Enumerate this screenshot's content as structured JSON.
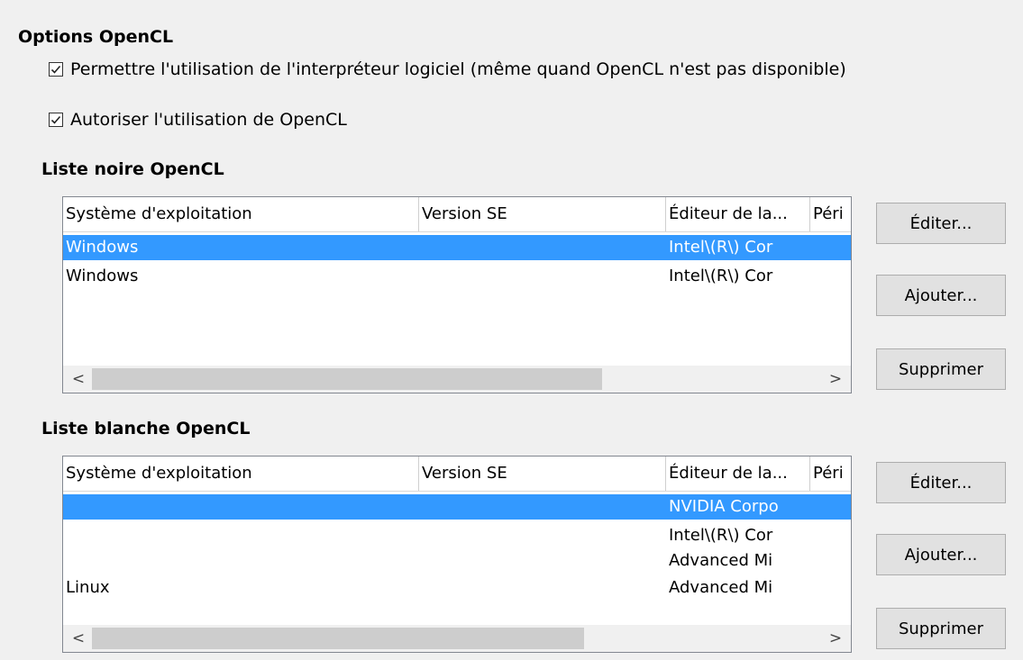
{
  "options_heading": "Options OpenCL",
  "checkboxes": [
    {
      "label": "Permettre l'utilisation de l'interpréteur logiciel (même quand OpenCL n'est pas disponible)",
      "checked": true
    },
    {
      "label": "Autoriser l'utilisation de OpenCL",
      "checked": true
    }
  ],
  "blacklist": {
    "heading": "Liste noire OpenCL",
    "columns": [
      "Système d'exploitation",
      "Version SE",
      "Éditeur de la...",
      "Péri"
    ],
    "rows": [
      {
        "os": "Windows",
        "version": "",
        "vendor": "Intel\\(R\\) Cor",
        "selected": true
      },
      {
        "os": "Windows",
        "version": "",
        "vendor": "Intel\\(R\\) Cor",
        "selected": false
      }
    ],
    "buttons": {
      "edit": "Éditer...",
      "add": "Ajouter...",
      "remove": "Supprimer"
    },
    "scroll_left": "<",
    "scroll_right": ">"
  },
  "whitelist": {
    "heading": "Liste blanche OpenCL",
    "columns": [
      "Système d'exploitation",
      "Version SE",
      "Éditeur de la...",
      "Péri"
    ],
    "rows": [
      {
        "os": "",
        "version": "",
        "vendor": "NVIDIA Corpo",
        "selected": true
      },
      {
        "os": "",
        "version": "",
        "vendor": "Intel\\(R\\) Cor",
        "selected": false
      },
      {
        "os": "",
        "version": "",
        "vendor": "Advanced Mi",
        "selected": false
      },
      {
        "os": "Linux",
        "version": "",
        "vendor": "Advanced Mi",
        "selected": false
      }
    ],
    "buttons": {
      "edit": "Éditer...",
      "add": "Ajouter...",
      "remove": "Supprimer"
    },
    "scroll_left": "<",
    "scroll_right": ">"
  },
  "colors": {
    "selection": "#3399ff",
    "button_bg": "#e1e1e1",
    "panel_bg": "#f0f0f0"
  }
}
